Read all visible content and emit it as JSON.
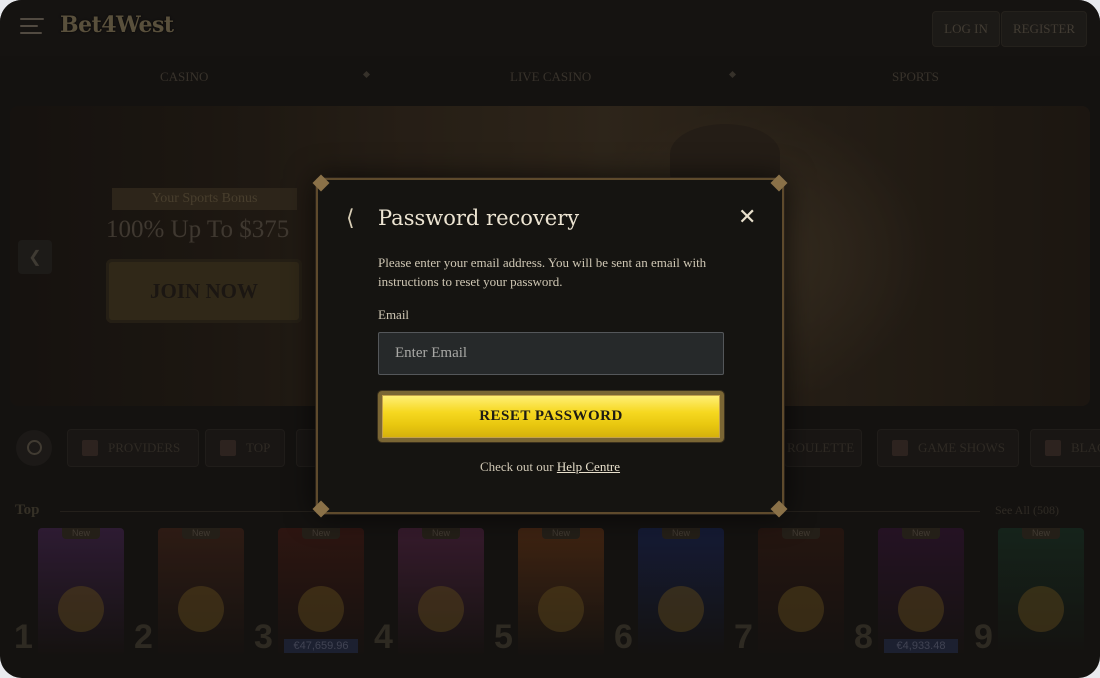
{
  "header": {
    "logo": "Bet4West",
    "login_label": "LOG IN",
    "register_label": "REGISTER"
  },
  "nav": {
    "items": [
      {
        "label": "CASINO"
      },
      {
        "label": "LIVE CASINO"
      },
      {
        "label": "SPORTS"
      }
    ]
  },
  "banner": {
    "tag": "Your Sports Bonus",
    "title": "100% Up To $375",
    "cta": "JOIN NOW"
  },
  "categories": [
    {
      "label": "PROVIDERS",
      "icon": "providers-icon"
    },
    {
      "label": "TOP",
      "icon": "star-icon"
    },
    {
      "label": "ROULETTE",
      "icon": "roulette-icon"
    },
    {
      "label": "GAME SHOWS",
      "icon": "microphone-icon"
    },
    {
      "label": "BLAC",
      "icon": "cards-icon"
    }
  ],
  "top_section": {
    "label": "Top",
    "see_all": "See All (508)",
    "new_badge": "New",
    "games": [
      {
        "rank": "1",
        "color": "#4a2a55"
      },
      {
        "rank": "2",
        "color": "#4a2a1e"
      },
      {
        "rank": "3",
        "color": "#4a2018",
        "jackpot": "€47,659.96"
      },
      {
        "rank": "4",
        "color": "#5a2a4a"
      },
      {
        "rank": "5",
        "color": "#6a3a1a"
      },
      {
        "rank": "6",
        "color": "#1e2a5a"
      },
      {
        "rank": "7",
        "color": "#3a2016"
      },
      {
        "rank": "8",
        "color": "#3a1a3a",
        "jackpot": "€4,933.48"
      },
      {
        "rank": "9",
        "color": "#1e3a2a"
      }
    ]
  },
  "modal": {
    "title": "Password recovery",
    "description": "Please enter your email address. You will be sent an email with instructions to reset your password.",
    "email_label": "Email",
    "email_placeholder": "Enter Email",
    "reset_label": "RESET PASSWORD",
    "help_prefix": "Check out our",
    "help_link": "Help Centre"
  },
  "colors": {
    "accent_gold": "#f6d820",
    "modal_border": "#5e4a2c",
    "background": "#1c1a17"
  }
}
